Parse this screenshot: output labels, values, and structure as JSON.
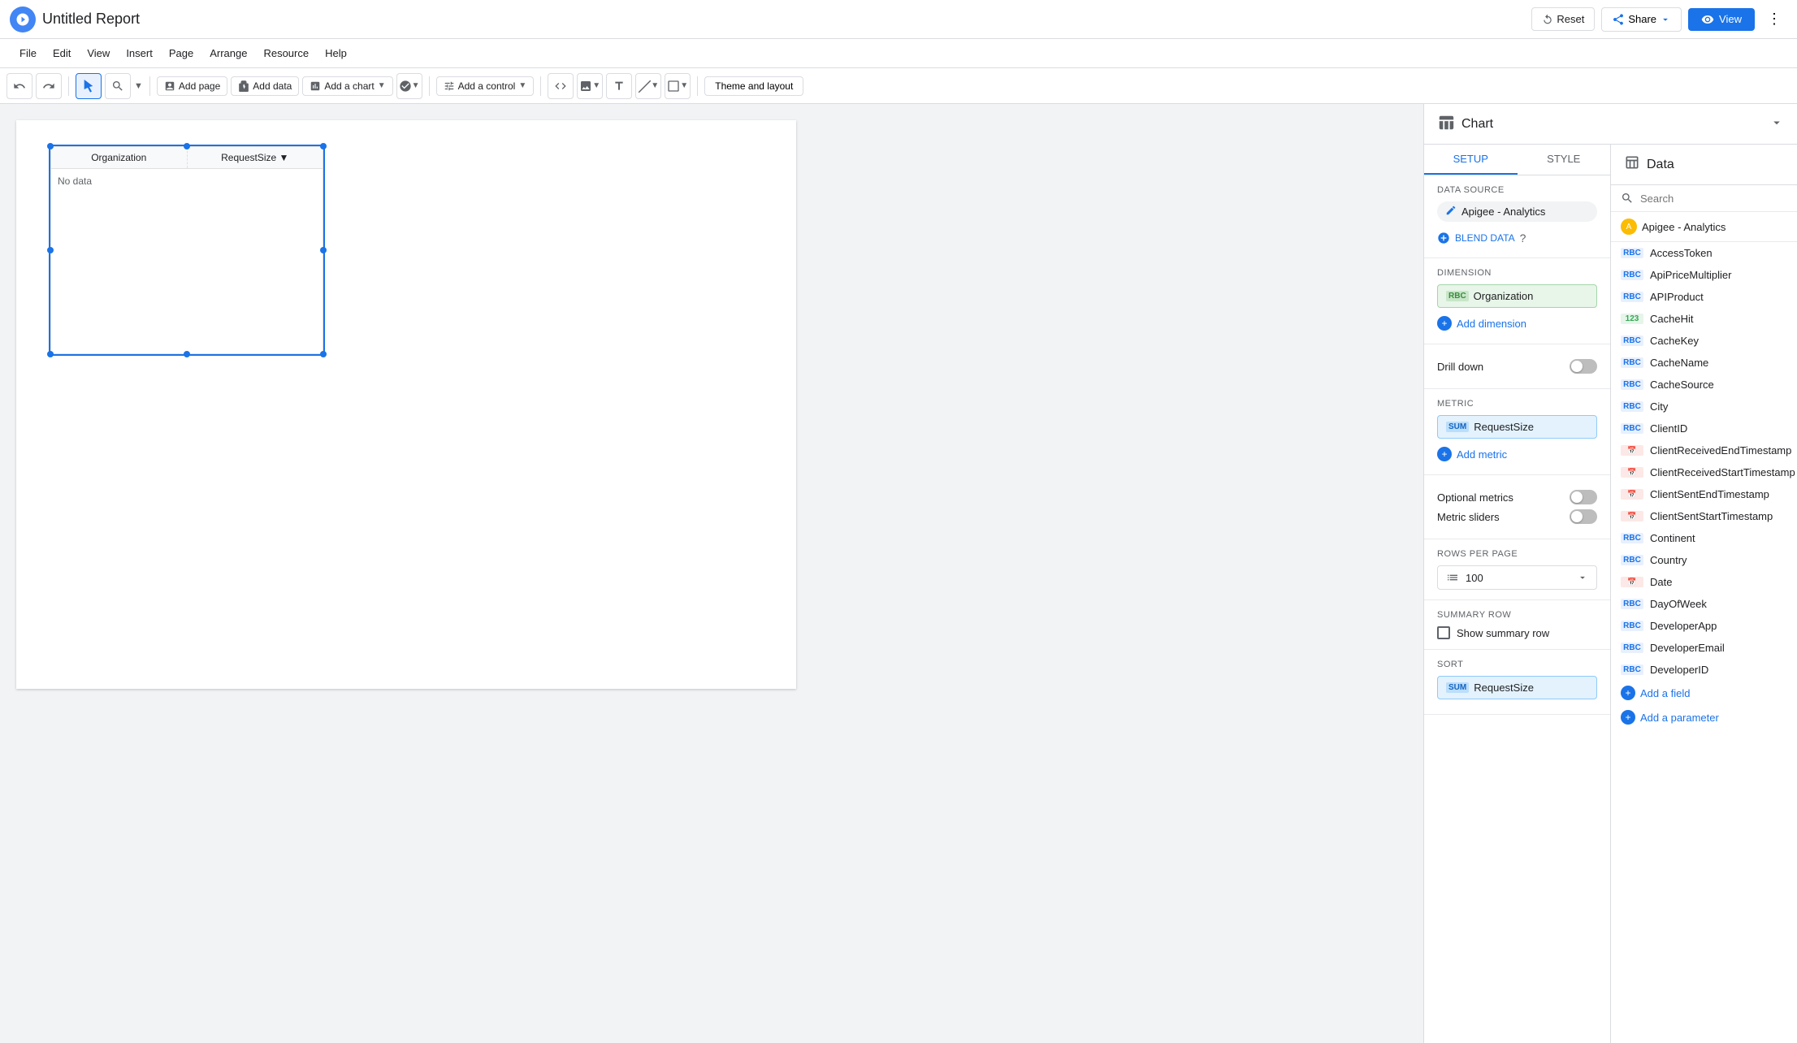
{
  "topbar": {
    "title": "Untitled Report",
    "reset_label": "Reset",
    "share_label": "Share",
    "view_label": "View"
  },
  "menubar": {
    "items": [
      "File",
      "Edit",
      "View",
      "Insert",
      "Page",
      "Arrange",
      "Resource",
      "Help"
    ]
  },
  "toolbar": {
    "add_page": "Add page",
    "add_data": "Add data",
    "add_chart": "Add a chart",
    "add_control": "Add a control",
    "theme_layout": "Theme and layout"
  },
  "chart_panel": {
    "title": "Chart",
    "tabs": [
      "SETUP",
      "STYLE"
    ],
    "active_tab": "SETUP"
  },
  "data_panel": {
    "title": "Data",
    "search_placeholder": "Search",
    "data_source": "Apigee - Analytics",
    "fields": [
      {
        "name": "AccessToken",
        "type": "rbc"
      },
      {
        "name": "ApiPriceMultiplier",
        "type": "rbc"
      },
      {
        "name": "APIProduct",
        "type": "rbc"
      },
      {
        "name": "CacheHit",
        "type": "123"
      },
      {
        "name": "CacheKey",
        "type": "rbc"
      },
      {
        "name": "CacheName",
        "type": "rbc"
      },
      {
        "name": "CacheSource",
        "type": "rbc"
      },
      {
        "name": "City",
        "type": "rbc"
      },
      {
        "name": "ClientID",
        "type": "rbc"
      },
      {
        "name": "ClientReceivedEndTimestamp",
        "type": "cal"
      },
      {
        "name": "ClientReceivedStartTimestamp",
        "type": "cal"
      },
      {
        "name": "ClientSentEndTimestamp",
        "type": "cal"
      },
      {
        "name": "ClientSentStartTimestamp",
        "type": "cal"
      },
      {
        "name": "Continent",
        "type": "rbc"
      },
      {
        "name": "Country",
        "type": "rbc"
      },
      {
        "name": "Date",
        "type": "cal"
      },
      {
        "name": "DayOfWeek",
        "type": "rbc"
      },
      {
        "name": "DeveloperApp",
        "type": "rbc"
      },
      {
        "name": "DeveloperEmail",
        "type": "rbc"
      },
      {
        "name": "DeveloperID",
        "type": "rbc"
      }
    ],
    "add_field": "Add a field",
    "add_parameter": "Add a parameter"
  },
  "setup": {
    "data_source_label": "Data source",
    "data_source_name": "Apigee - Analytics",
    "blend_data": "BLEND DATA",
    "dimension_label": "Dimension",
    "dimension_field": "Organization",
    "add_dimension": "Add dimension",
    "drill_down_label": "Drill down",
    "metric_label": "Metric",
    "metric_field": "RequestSize",
    "add_metric": "Add metric",
    "optional_metrics_label": "Optional metrics",
    "metric_sliders_label": "Metric sliders",
    "rows_per_page_label": "Rows per Page",
    "rows_per_page_value": "100",
    "summary_row_label": "Summary row",
    "show_summary_row": "Show summary row",
    "sort_label": "Sort",
    "sort_field": "RequestSize"
  },
  "canvas": {
    "chart_col1": "Organization",
    "chart_col2": "RequestSize ▼",
    "no_data_text": "No data"
  }
}
